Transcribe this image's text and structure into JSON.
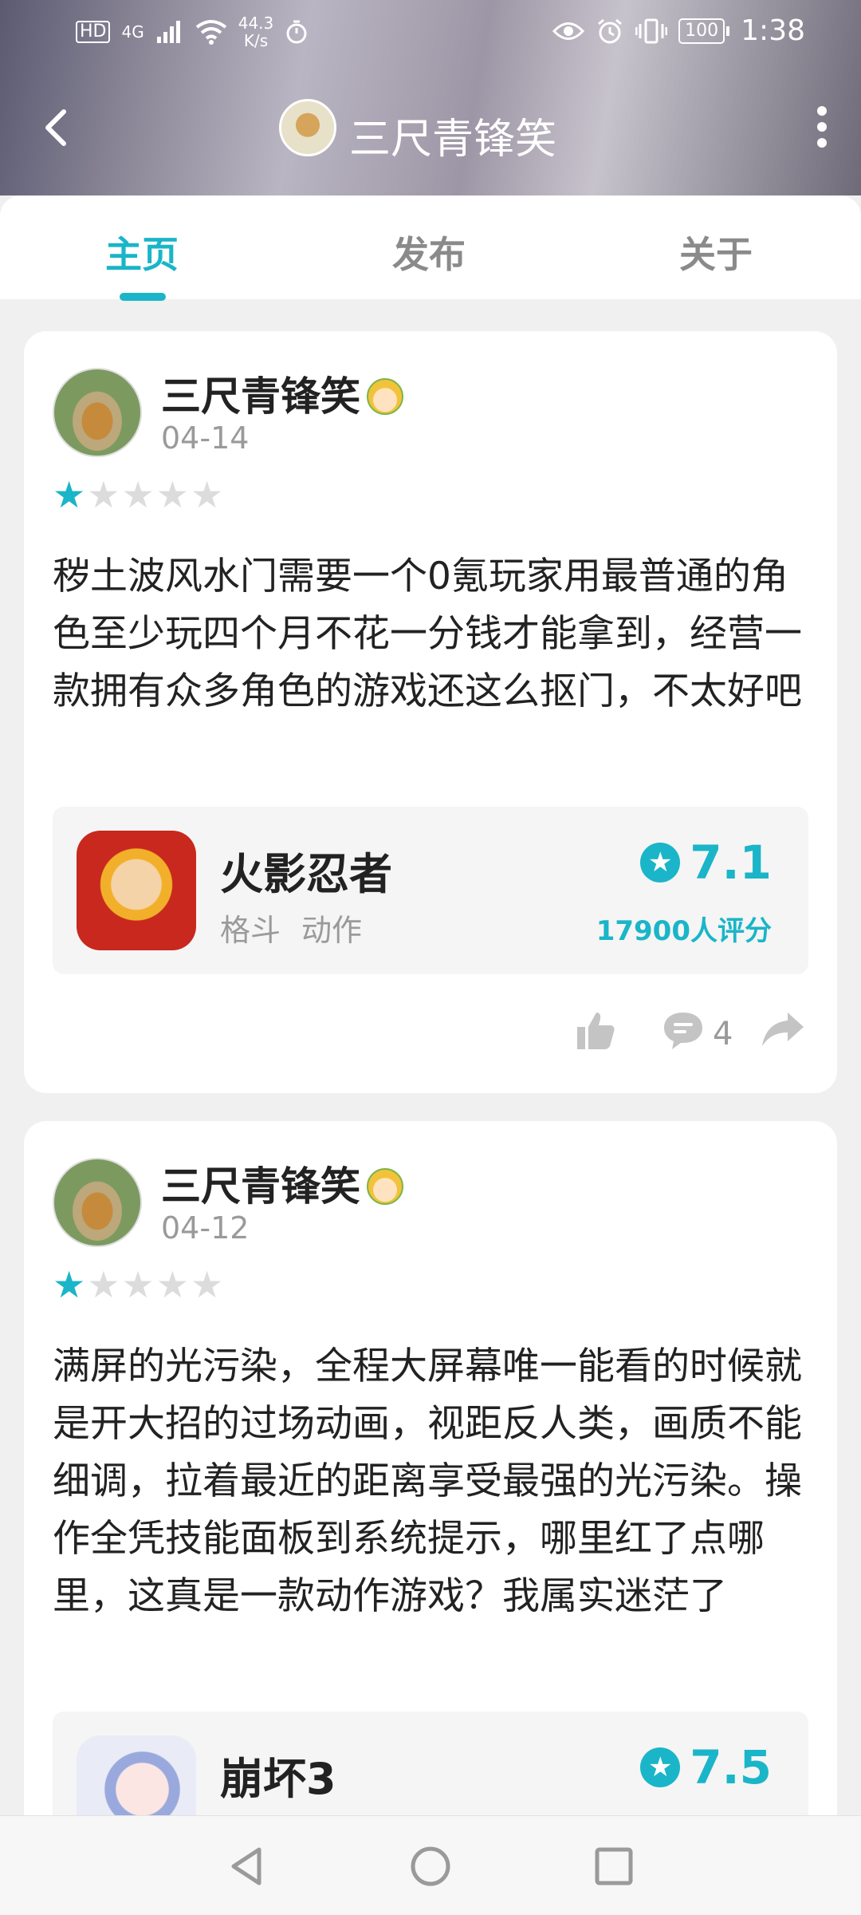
{
  "status_bar": {
    "badge": "HD",
    "network": "4G",
    "speed_value": "44.3",
    "speed_unit": "K/s",
    "battery": "100",
    "time": "1:38"
  },
  "header": {
    "title": "三尺青锋笑"
  },
  "tabs": [
    {
      "label": "主页",
      "active": true
    },
    {
      "label": "发布",
      "active": false
    },
    {
      "label": "关于",
      "active": false
    }
  ],
  "posts": [
    {
      "author": "三尺青锋笑",
      "date": "04-14",
      "rating_stars": 1,
      "text": "秽土波风水门需要一个0氪玩家用最普通的角色至少玩四个月不花一分钱才能拿到，经营一款拥有众多角色的游戏还这么抠门，不太好吧",
      "game": {
        "name": "火影忍者",
        "tags": [
          "格斗",
          "动作"
        ],
        "score": "7.1",
        "rating_count": "17900人评分"
      },
      "comment_count": "4"
    },
    {
      "author": "三尺青锋笑",
      "date": "04-12",
      "rating_stars": 1,
      "text": "满屏的光污染，全程大屏幕唯一能看的时候就是开大招的过场动画，视距反人类，画质不能细调，拉着最近的距离享受最强的光污染。操作全凭技能面板到系统提示，哪里红了点哪里，这真是一款动作游戏？我属实迷茫了",
      "game": {
        "name": "崩坏3",
        "score": "7.5"
      }
    }
  ],
  "colors": {
    "accent": "#1ab5c8"
  }
}
